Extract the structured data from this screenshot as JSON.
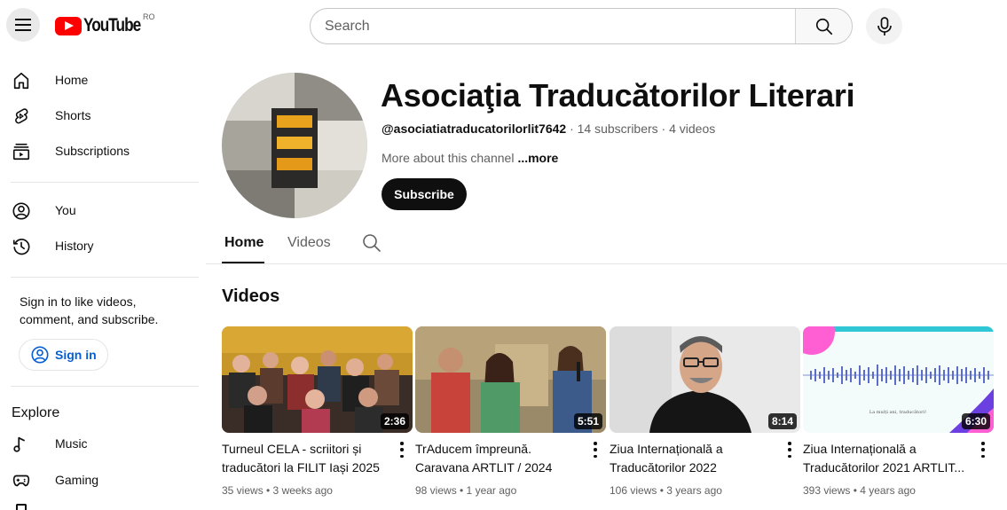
{
  "header": {
    "logo_text": "YouTube",
    "region": "RO",
    "search_placeholder": "Search"
  },
  "sidebar": {
    "items": [
      {
        "label": "Home",
        "icon": "home-icon"
      },
      {
        "label": "Shorts",
        "icon": "shorts-icon"
      },
      {
        "label": "Subscriptions",
        "icon": "subscriptions-icon"
      },
      {
        "label": "You",
        "icon": "you-icon"
      },
      {
        "label": "History",
        "icon": "history-icon"
      }
    ],
    "signin_prompt": "Sign in to like videos, comment, and subscribe.",
    "signin_label": "Sign in",
    "explore_title": "Explore",
    "explore_items": [
      {
        "label": "Music",
        "icon": "music-icon"
      },
      {
        "label": "Gaming",
        "icon": "gaming-icon"
      }
    ]
  },
  "channel": {
    "name": "Asociaţia Traducătorilor Literari",
    "handle": "@asociatiatraducatorilorlit7642",
    "stats": " · 14 subscribers · 4 videos",
    "about": "More about this channel",
    "more": "...more",
    "subscribe_label": "Subscribe"
  },
  "tabs": [
    {
      "label": "Home",
      "active": true
    },
    {
      "label": "Videos",
      "active": false
    }
  ],
  "section_title": "Videos",
  "videos": [
    {
      "title_line1": "Turneul CELA - scriitori și",
      "title_line2": "traducători la FILIT Iași 2025",
      "duration": "2:36",
      "meta": "35 views • 3 weeks ago"
    },
    {
      "title_line1": "TrAducem împreună.",
      "title_line2": "Caravana ARTLIT / 2024",
      "duration": "5:51",
      "meta": "98 views • 1 year ago"
    },
    {
      "title_line1": "Ziua Internațională a",
      "title_line2": "Traducătorilor 2022",
      "duration": "8:14",
      "meta": "106 views • 3 years ago"
    },
    {
      "title_line1": "Ziua Internațională a",
      "title_line2": "Traducătorilor 2021 ARTLIT...",
      "duration": "6:30",
      "meta": "393 views • 4 years ago",
      "thumb_caption": "La mulți ani, traducători!"
    }
  ],
  "colors": {
    "brand_red": "#ff0000",
    "link_blue": "#065fd4",
    "text_primary": "#0f0f0f",
    "text_secondary": "#606060"
  }
}
